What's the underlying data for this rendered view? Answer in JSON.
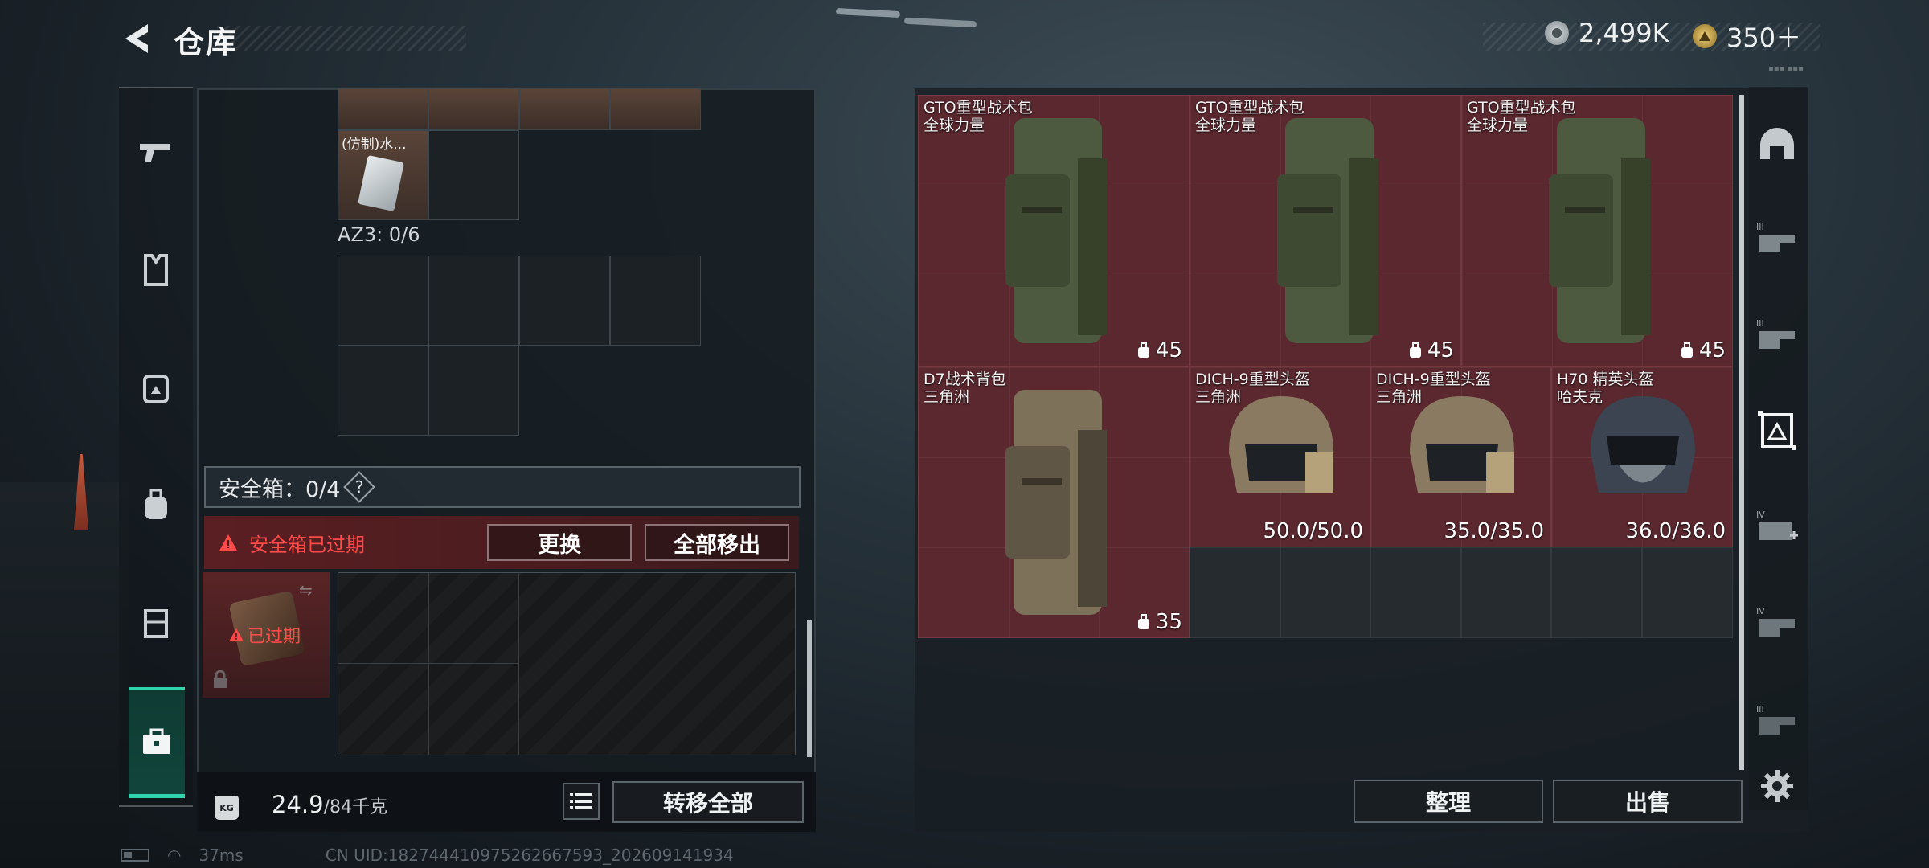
{
  "header": {
    "title": "仓库",
    "back_icon": "back-arrow-icon"
  },
  "currency": [
    {
      "icon": "silver-coin-icon",
      "value": "2,499K",
      "color": "#c8cdd0"
    },
    {
      "icon": "gold-coin-icon",
      "value": "350＋",
      "color": "#d6b45a"
    }
  ],
  "left_nav": {
    "items": [
      "gun-icon",
      "vest-icon",
      "backpack-icon",
      "bag-icon",
      "chest-rig-icon",
      "briefcase-icon"
    ],
    "active": "briefcase-icon",
    "accent": "#2fd3ad"
  },
  "container": {
    "item_label": "(仿制)水...",
    "az3_label": "AZ3: 0/6",
    "safe_label": "安全箱：0/4",
    "safe_help": "?",
    "expired_warning": "安全箱已过期",
    "replace_button": "更换",
    "move_all_out_button": "全部移出",
    "expired_badge": "已过期"
  },
  "bottom": {
    "weight_current": "24.9",
    "weight_max": "/84千克",
    "weight_icon_text": "KG",
    "transfer_all_button": "转移全部"
  },
  "stash": {
    "items": [
      {
        "name": "GTO重型战术包",
        "maker": "全球力量",
        "value": "45",
        "icon": "backpack"
      },
      {
        "name": "GTO重型战术包",
        "maker": "全球力量",
        "value": "45",
        "icon": "backpack"
      },
      {
        "name": "GTO重型战术包",
        "maker": "全球力量",
        "value": "45",
        "icon": "backpack"
      },
      {
        "name": "D7战术背包",
        "maker": "三角洲",
        "value": "35",
        "icon": "backpack"
      },
      {
        "name": "DICH-9重型头盔",
        "maker": "三角洲",
        "value": "50.0/50.0",
        "icon": "helmet"
      },
      {
        "name": "DICH-9重型头盔",
        "maker": "三角洲",
        "value": "35.0/35.0",
        "icon": "helmet"
      },
      {
        "name": "H70 精英头盔",
        "maker": "哈夫克",
        "value": "36.0/36.0",
        "icon": "helmet-dark"
      }
    ],
    "sort_button": "整理",
    "sell_button": "出售",
    "item_bg": "#5a282e"
  },
  "right_nav": {
    "items": [
      "helmet-icon",
      "armor-iii-icon",
      "armor-iii-icon",
      "backpack-select-icon",
      "armor-iv-add-icon",
      "armor-iv-icon",
      "armor-iii-icon"
    ],
    "settings_icon": "gear-icon"
  },
  "status": {
    "ping": "37ms",
    "uid": "CN UID:18274441097526266​7593_202609141934"
  }
}
